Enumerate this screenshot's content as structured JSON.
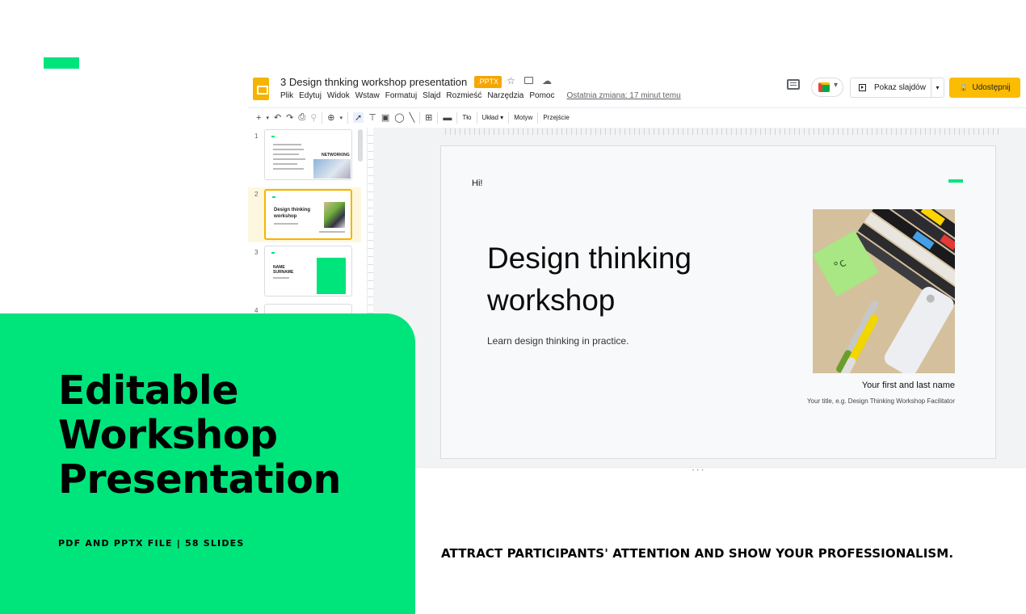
{
  "app": {
    "title": "3 Design thnking workshop presentation",
    "file_badge": ".PPTX",
    "menu": [
      "Plik",
      "Edytuj",
      "Widok",
      "Wstaw",
      "Formatuj",
      "Slajd",
      "Rozmieść",
      "Narzędzia",
      "Pomoc"
    ],
    "last_edit": "Ostatnia zmiana: 17 minut temu",
    "present_label": "Pokaz slajdów",
    "share_label": "Udostępnij",
    "toolbar": {
      "background": "Tło",
      "layout": "Układ ▾",
      "theme": "Motyw",
      "transition": "Przejście"
    },
    "icons": {
      "logo": "slides-logo-icon",
      "star": "star-icon",
      "move": "move-to-folder-icon",
      "cloud": "cloud-status-icon",
      "comments": "comment-icon",
      "meet": "meet-icon",
      "lock": "lock-icon"
    }
  },
  "filmstrip": {
    "slides": [
      {
        "number": "1",
        "label": "NETWORKING"
      },
      {
        "number": "2",
        "title": "Design thinking workshop"
      },
      {
        "number": "3",
        "name": "NAME SURNAME"
      },
      {
        "number": "4"
      }
    ]
  },
  "slide": {
    "greeting": "Hi!",
    "title": "Design thinking workshop",
    "subtitle": "Learn design thinking in practice.",
    "name": "Your first and last name",
    "role": "Your title, e.g. Design Thinking Workshop Facilitator"
  },
  "promo": {
    "heading": "Editable Workshop Presentation",
    "subheading": "PDF AND PPTX FILE | 58 SLIDES",
    "tagline": "ATTRACT PARTICIPANTS' ATTENTION AND SHOW YOUR PROFESSIONALISM."
  },
  "colors": {
    "accent_green": "#00e47c",
    "share_yellow": "#fbbc04",
    "slides_yellow": "#f4b400"
  }
}
